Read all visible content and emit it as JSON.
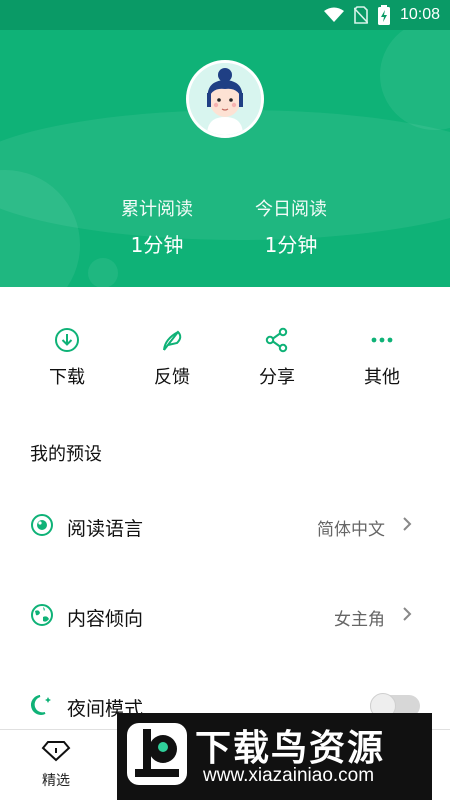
{
  "status_bar": {
    "time": "10:08",
    "icons": [
      "wifi-icon",
      "no-sim-icon",
      "battery-charging-icon"
    ]
  },
  "stats": [
    {
      "label": "累计阅读",
      "value": "1分钟"
    },
    {
      "label": "今日阅读",
      "value": "1分钟"
    }
  ],
  "actions": [
    {
      "label": "下载",
      "icon": "download-icon"
    },
    {
      "label": "反馈",
      "icon": "feather-icon"
    },
    {
      "label": "分享",
      "icon": "share-icon"
    },
    {
      "label": "其他",
      "icon": "more-icon"
    }
  ],
  "presets": {
    "title": "我的预设",
    "items": [
      {
        "label": "阅读语言",
        "value": "简体中文",
        "icon": "eye-icon"
      },
      {
        "label": "内容倾向",
        "value": "女主角",
        "icon": "globe-icon"
      },
      {
        "label": "夜间模式",
        "icon": "moon-icon",
        "toggle_on": false
      }
    ]
  },
  "bottom_nav": {
    "items": [
      {
        "label": "精选",
        "icon": "diamond-icon"
      }
    ]
  },
  "watermark": {
    "title": "下载鸟资源",
    "url": "www.xiazainiao.com"
  },
  "colors": {
    "primary": "#0fb277",
    "status_bar": "#0a9a66"
  }
}
